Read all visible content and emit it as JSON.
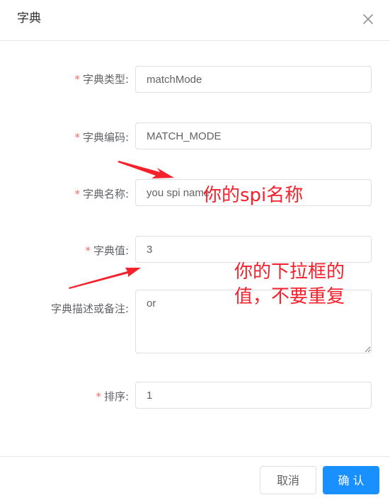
{
  "dialog": {
    "title": "字典",
    "close_icon": "close-icon"
  },
  "form": {
    "required_mark": "*",
    "fields": [
      {
        "label": "字典类型:",
        "value": "matchMode",
        "required": true
      },
      {
        "label": "字典编码:",
        "value": "MATCH_MODE",
        "required": true
      },
      {
        "label": "字典名称:",
        "value": "you spi name",
        "required": true
      },
      {
        "label": "字典值:",
        "value": "3",
        "required": true
      },
      {
        "label": "字典描述或备注:",
        "value": "or",
        "required": false
      },
      {
        "label": "排序:",
        "value": "1",
        "required": true
      }
    ]
  },
  "annotations": {
    "name_note": "你的spi名称",
    "value_note_line1": "你的下拉框的",
    "value_note_line2": "值，不要重复",
    "color": "#f5222d"
  },
  "footer": {
    "cancel_label": "取消",
    "confirm_label": "确 认"
  },
  "colors": {
    "primary": "#1890ff",
    "required": "#f56c6c",
    "border": "#dcdfe6",
    "label": "#606266"
  }
}
